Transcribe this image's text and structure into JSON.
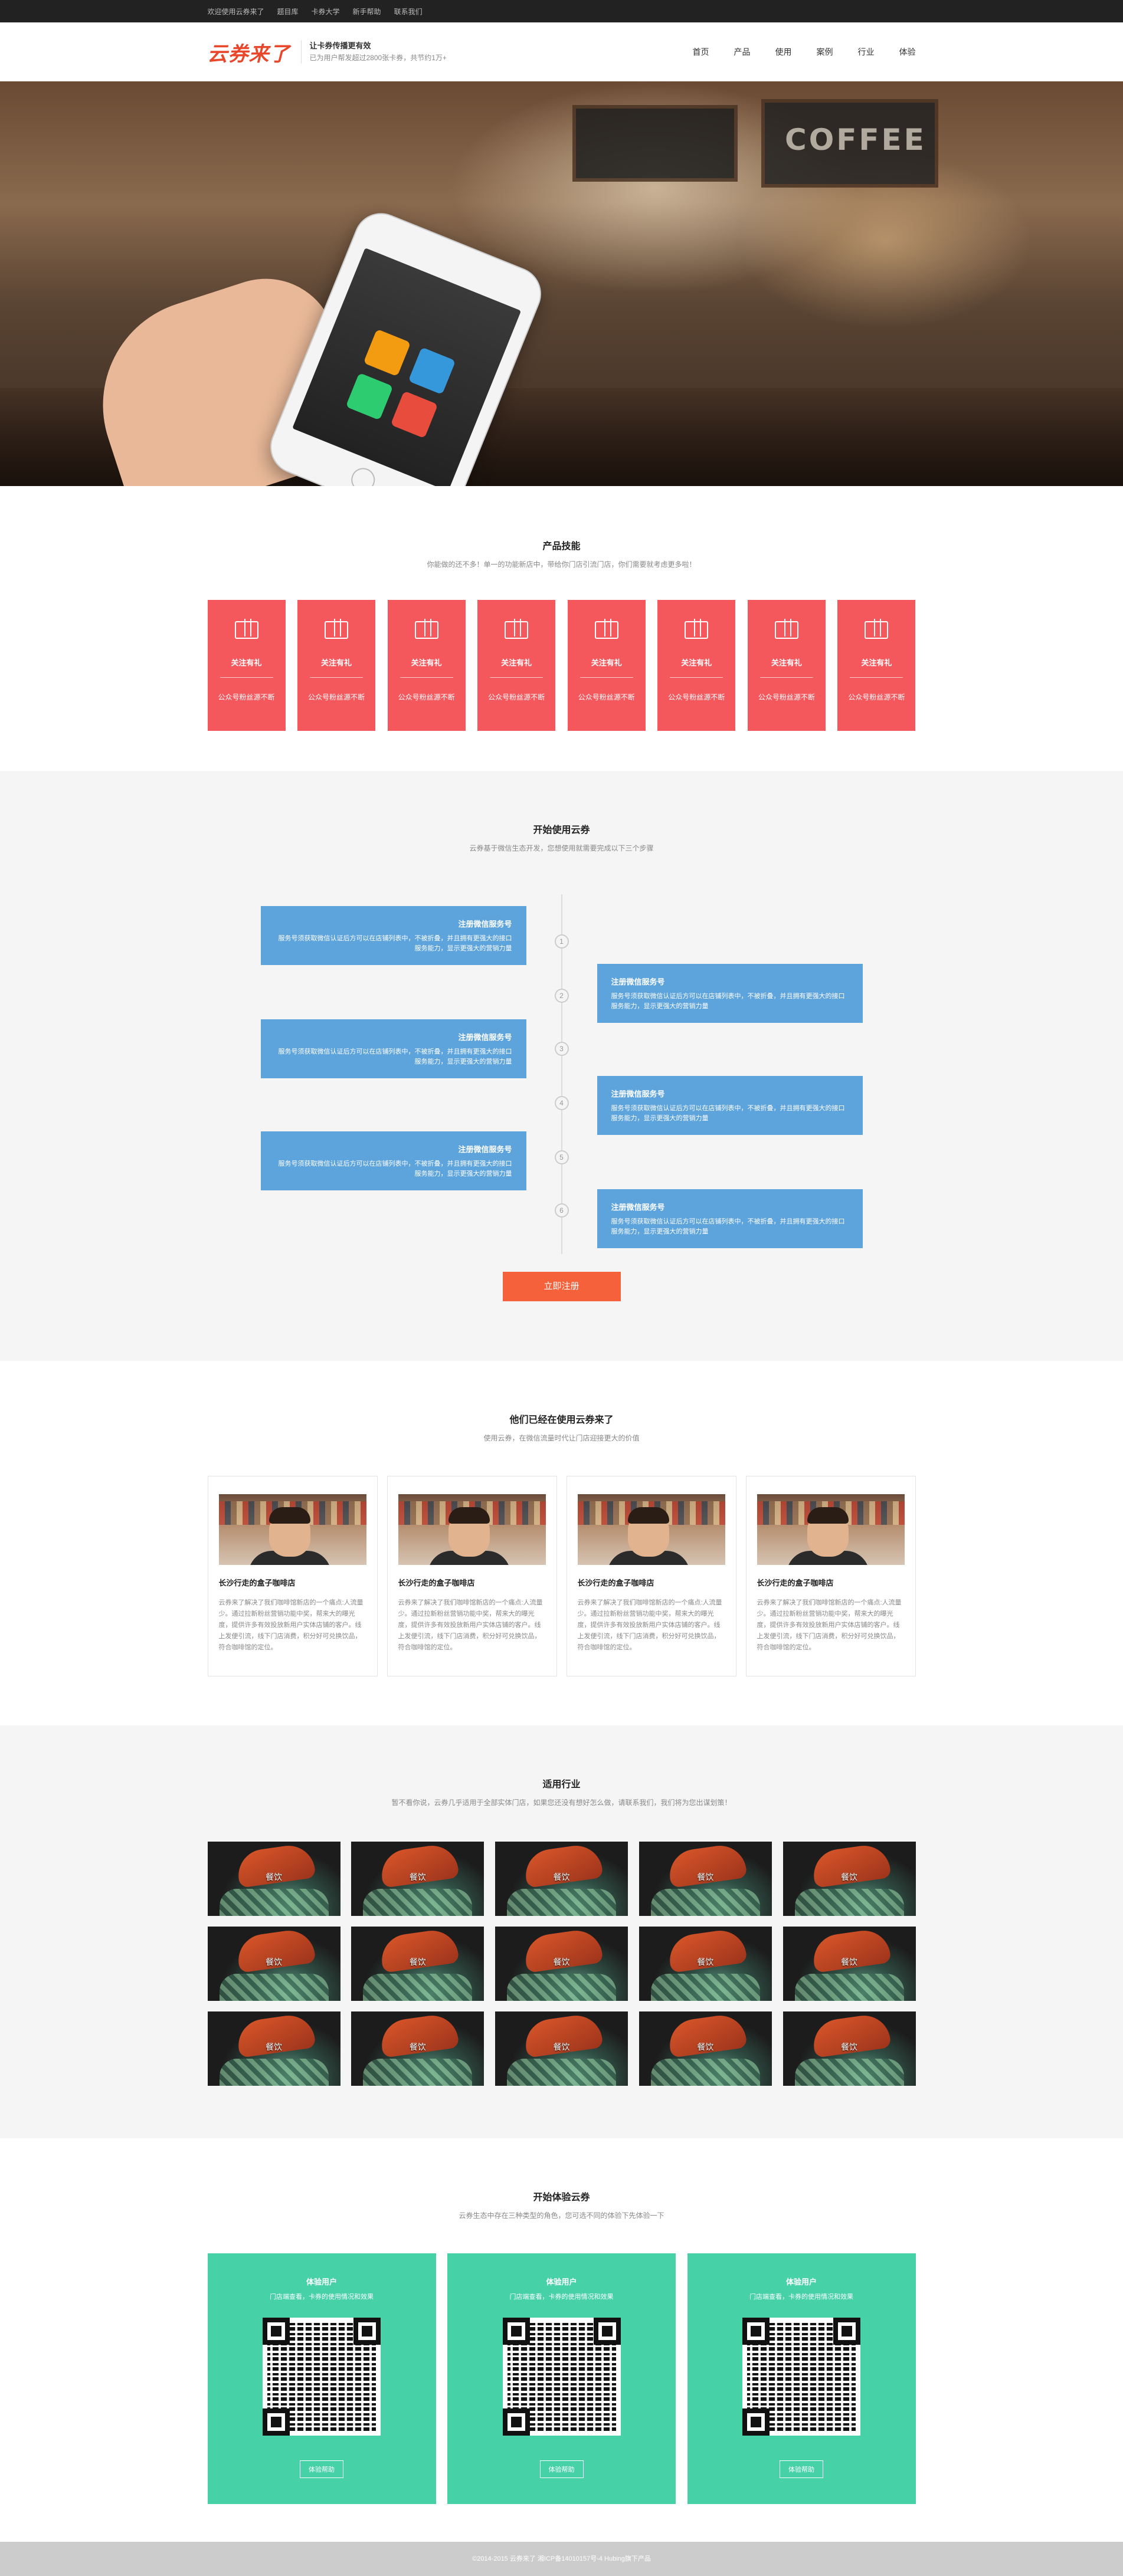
{
  "topbar": {
    "links": [
      "欢迎使用云券来了",
      "题目库",
      "卡券大学",
      "新手帮助",
      "联系我们"
    ]
  },
  "header": {
    "logo": "云券来了",
    "slogan_title": "让卡券传播更有效",
    "slogan_sub": "已为用户帮发超过2800张卡券，共节约1万+",
    "nav": [
      "首页",
      "产品",
      "使用",
      "案例",
      "行业",
      "体验"
    ]
  },
  "skills": {
    "title": "产品技能",
    "subtitle": "你能做的还不多！单一的功能新店中，带给你门店引流门店，你们需要就考虑更多啦！",
    "cards": [
      {
        "title": "关注有礼",
        "desc": "公众号粉丝源不断"
      },
      {
        "title": "关注有礼",
        "desc": "公众号粉丝源不断"
      },
      {
        "title": "关注有礼",
        "desc": "公众号粉丝源不断"
      },
      {
        "title": "关注有礼",
        "desc": "公众号粉丝源不断"
      },
      {
        "title": "关注有礼",
        "desc": "公众号粉丝源不断"
      },
      {
        "title": "关注有礼",
        "desc": "公众号粉丝源不断"
      },
      {
        "title": "关注有礼",
        "desc": "公众号粉丝源不断"
      },
      {
        "title": "关注有礼",
        "desc": "公众号粉丝源不断"
      }
    ]
  },
  "timeline": {
    "title": "开始使用云券",
    "subtitle": "云券基于微信生态开发，您想使用就需要完成以下三个步骤",
    "steps": [
      {
        "num": "1",
        "title": "注册微信服务号",
        "desc": "服务号须获取微信认证后方可以在店铺列表中，不被折叠，并且拥有更强大的接口服务能力，显示更强大的营销力量"
      },
      {
        "num": "2",
        "title": "注册微信服务号",
        "desc": "服务号须获取微信认证后方可以在店铺列表中，不被折叠，并且拥有更强大的接口服务能力，显示更强大的营销力量"
      },
      {
        "num": "3",
        "title": "注册微信服务号",
        "desc": "服务号须获取微信认证后方可以在店铺列表中，不被折叠，并且拥有更强大的接口服务能力，显示更强大的营销力量"
      },
      {
        "num": "4",
        "title": "注册微信服务号",
        "desc": "服务号须获取微信认证后方可以在店铺列表中，不被折叠，并且拥有更强大的接口服务能力，显示更强大的营销力量"
      },
      {
        "num": "5",
        "title": "注册微信服务号",
        "desc": "服务号须获取微信认证后方可以在店铺列表中，不被折叠，并且拥有更强大的接口服务能力，显示更强大的营销力量"
      },
      {
        "num": "6",
        "title": "注册微信服务号",
        "desc": "服务号须获取微信认证后方可以在店铺列表中，不被折叠，并且拥有更强大的接口服务能力，显示更强大的营销力量"
      }
    ],
    "cta": "立即注册"
  },
  "cases": {
    "title": "他们已经在使用云券来了",
    "subtitle": "使用云券，在微信流量时代让门店迎接更大的价值",
    "items": [
      {
        "title": "长沙行走的盒子咖啡店",
        "desc": "云券来了解决了我们咖啡馆新店的一个痛点:人流量少。通过拉新粉丝营销功能中奖，帮来大的曝光度，提供许多有效投放新用户实体店铺的客户。线上发便引流，线下门店消费，积分好可兑换饮品，符合咖啡馆的定位。"
      },
      {
        "title": "长沙行走的盒子咖啡店",
        "desc": "云券来了解决了我们咖啡馆新店的一个痛点:人流量少。通过拉新粉丝营销功能中奖，帮来大的曝光度，提供许多有效投放新用户实体店铺的客户。线上发便引流，线下门店消费，积分好可兑换饮品，符合咖啡馆的定位。"
      },
      {
        "title": "长沙行走的盒子咖啡店",
        "desc": "云券来了解决了我们咖啡馆新店的一个痛点:人流量少。通过拉新粉丝营销功能中奖，帮来大的曝光度，提供许多有效投放新用户实体店铺的客户。线上发便引流，线下门店消费，积分好可兑换饮品，符合咖啡馆的定位。"
      },
      {
        "title": "长沙行走的盒子咖啡店",
        "desc": "云券来了解决了我们咖啡馆新店的一个痛点:人流量少。通过拉新粉丝营销功能中奖，帮来大的曝光度，提供许多有效投放新用户实体店铺的客户。线上发便引流，线下门店消费，积分好可兑换饮品，符合咖啡馆的定位。"
      }
    ]
  },
  "industries": {
    "title": "适用行业",
    "subtitle": "暂不看你说，云券几乎适用于全部实体门店，如果您还没有想好怎么做，请联系我们，我们将为您出谋划策！",
    "tiles": [
      "餐饮",
      "餐饮",
      "餐饮",
      "餐饮",
      "餐饮",
      "餐饮",
      "餐饮",
      "餐饮",
      "餐饮",
      "餐饮",
      "餐饮",
      "餐饮",
      "餐饮",
      "餐饮",
      "餐饮"
    ]
  },
  "experience": {
    "title": "开始体验云券",
    "subtitle": "云券生态中存在三种类型的角色，您可选不同的体验下先体验一下",
    "cards": [
      {
        "title": "体验用户",
        "sub": "门店端查看，卡券的使用情况和效果",
        "button": "体验帮助"
      },
      {
        "title": "体验用户",
        "sub": "门店端查看，卡券的使用情况和效果",
        "button": "体验帮助"
      },
      {
        "title": "体验用户",
        "sub": "门店端查看，卡券的使用情况和效果",
        "button": "体验帮助"
      }
    ]
  },
  "footer": {
    "text": "©2014-2015 云券来了 湘ICP备14010157号-4 Hubing旗下产品"
  },
  "colors": {
    "accent_red": "#f4585d",
    "timeline_blue": "#5da3dc",
    "cta_orange": "#f4613b",
    "experience_green": "#46d1a7"
  }
}
